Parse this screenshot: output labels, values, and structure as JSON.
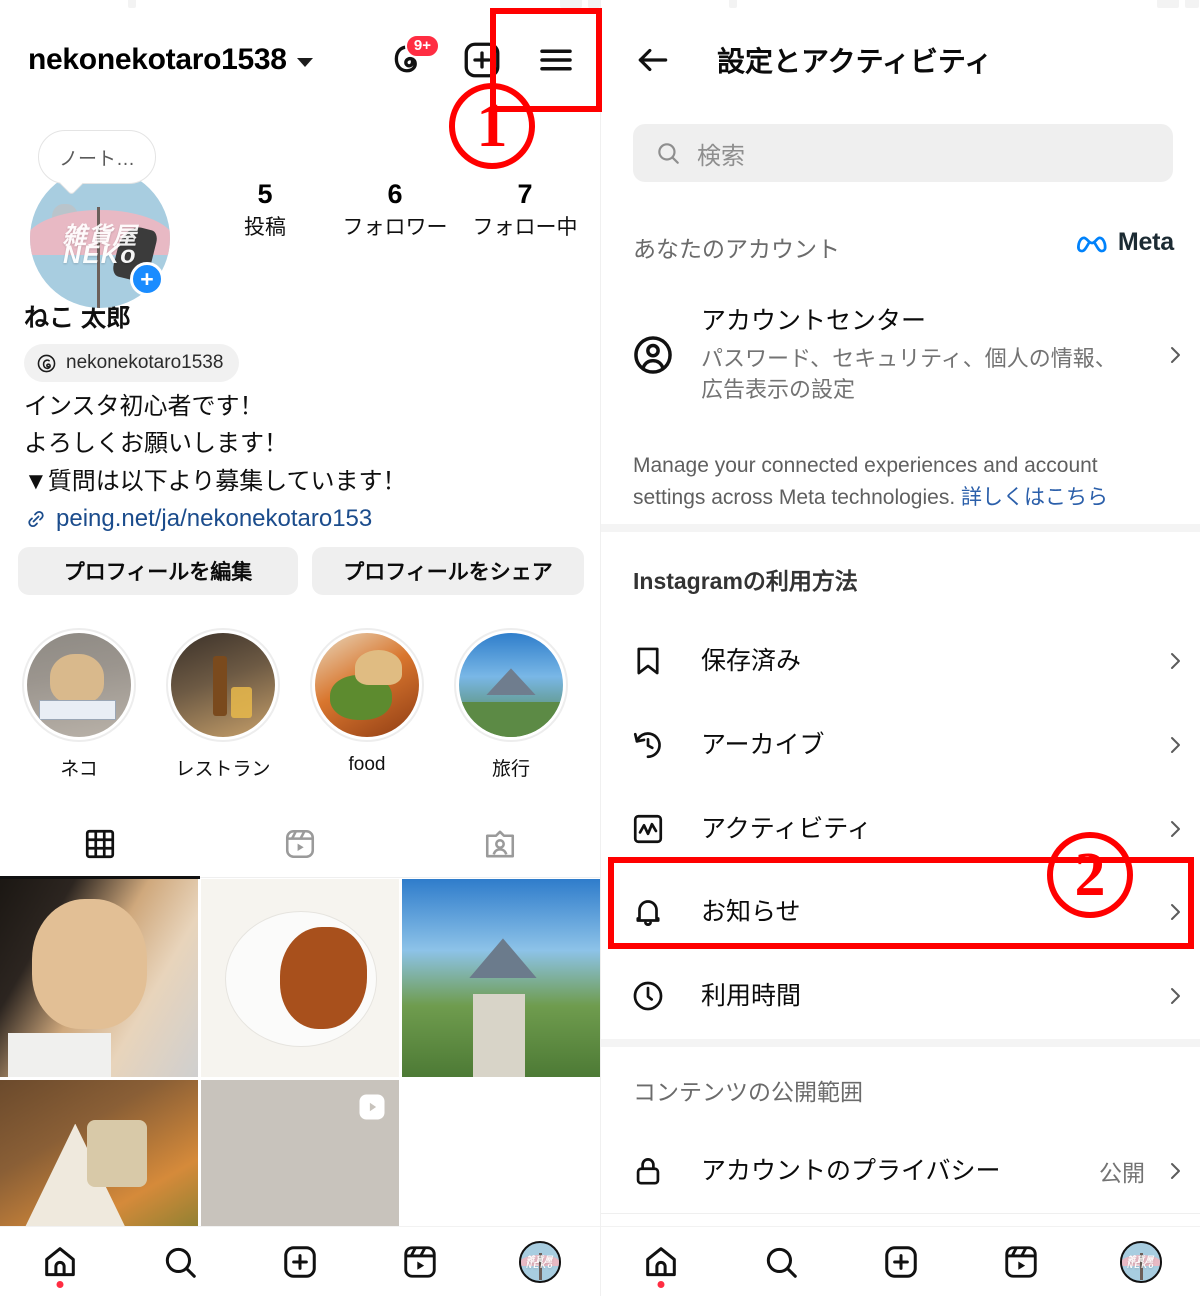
{
  "left": {
    "header": {
      "username": "nekonekotaro1538",
      "dropdown_icon": "chevron-down-icon",
      "threads_icon": "threads-icon",
      "threads_badge": "9+",
      "add_icon": "plus-square-icon",
      "menu_icon": "hamburger-menu-icon"
    },
    "profile": {
      "note_text": "ノート…",
      "avatar_text_top": "雑貨屋",
      "avatar_text_bottom": "NEKo",
      "add_story_label": "+",
      "full_name": "ねこ 太郎",
      "threads_handle": "nekonekotaro1538",
      "stats": [
        {
          "num": "5",
          "label": "投稿"
        },
        {
          "num": "6",
          "label": "フォロワー"
        },
        {
          "num": "7",
          "label": "フォロー中"
        }
      ],
      "bio_lines": [
        "インスタ初心者です！",
        "よろしくお願いします！",
        "▼質問は以下より募集しています！"
      ],
      "bio_link": "peing.net/ja/nekonekotaro153"
    },
    "buttons": {
      "edit_profile": "プロフィールを編集",
      "share_profile": "プロフィールをシェア"
    },
    "highlights": [
      {
        "label": "ネコ"
      },
      {
        "label": "レストラン"
      },
      {
        "label": "food"
      },
      {
        "label": "旅行"
      }
    ],
    "tabs": [
      {
        "name": "grid-tab",
        "icon": "grid-icon",
        "active": true
      },
      {
        "name": "reels-tab",
        "icon": "reels-icon",
        "active": false
      },
      {
        "name": "tagged-tab",
        "icon": "tagged-person-icon",
        "active": false
      }
    ],
    "grid": [
      {
        "name": "post-cat",
        "kind": "photo"
      },
      {
        "name": "post-curry",
        "kind": "photo"
      },
      {
        "name": "post-landscape",
        "kind": "photo"
      },
      {
        "name": "post-salad",
        "kind": "photo"
      },
      {
        "name": "post-reel",
        "kind": "reel"
      }
    ]
  },
  "right": {
    "header": {
      "back_icon": "back-arrow-icon",
      "title": "設定とアクティビティ"
    },
    "search": {
      "placeholder": "検索",
      "icon": "search-icon",
      "value": ""
    },
    "sections": [
      {
        "heading": "あなたのアカウント",
        "brand": "Meta",
        "brand_icon": "meta-infinity-icon"
      },
      {
        "heading": "Instagramの利用方法"
      },
      {
        "heading": "コンテンツの公開範囲"
      }
    ],
    "account_center": {
      "icon": "account-circle-icon",
      "title": "アカウントセンター",
      "subtitle": "パスワード、セキュリティ、個人の情報、広告表示の設定",
      "chevron": "chevron-right-icon"
    },
    "meta_description": {
      "text": "Manage your connected experiences and account settings across Meta technologies.",
      "link": "詳しくはこちら"
    },
    "rows": [
      {
        "icon": "bookmark-icon",
        "label": "保存済み",
        "value": "",
        "chevron": "chevron-right-icon"
      },
      {
        "icon": "archive-clock-icon",
        "label": "アーカイブ",
        "value": "",
        "chevron": "chevron-right-icon"
      },
      {
        "icon": "activity-chart-icon",
        "label": "アクティビティ",
        "value": "",
        "chevron": "chevron-right-icon"
      },
      {
        "icon": "bell-icon",
        "label": "お知らせ",
        "value": "",
        "chevron": "chevron-right-icon"
      },
      {
        "icon": "clock-icon",
        "label": "利用時間",
        "value": "",
        "chevron": "chevron-right-icon"
      }
    ],
    "privacy_row": {
      "icon": "lock-icon",
      "label": "アカウントのプライバシー",
      "value": "公開",
      "chevron": "chevron-right-icon"
    }
  },
  "bottom_nav": [
    {
      "name": "home-icon",
      "label": ""
    },
    {
      "name": "search-icon",
      "label": ""
    },
    {
      "name": "create-plus-icon",
      "label": ""
    },
    {
      "name": "reels-icon",
      "label": ""
    },
    {
      "name": "profile-avatar",
      "label": ""
    }
  ],
  "annotations": [
    {
      "id": "1",
      "label": "1",
      "target": "hamburger-menu-icon"
    },
    {
      "id": "2",
      "label": "2",
      "target": "notifications-row"
    }
  ],
  "colors": {
    "accent_red": "#ff0000",
    "badge_red": "#ff2d42",
    "meta_blue": "#0082fb",
    "link_blue": "#2b5faa",
    "story_add_blue": "#1a8cff"
  }
}
